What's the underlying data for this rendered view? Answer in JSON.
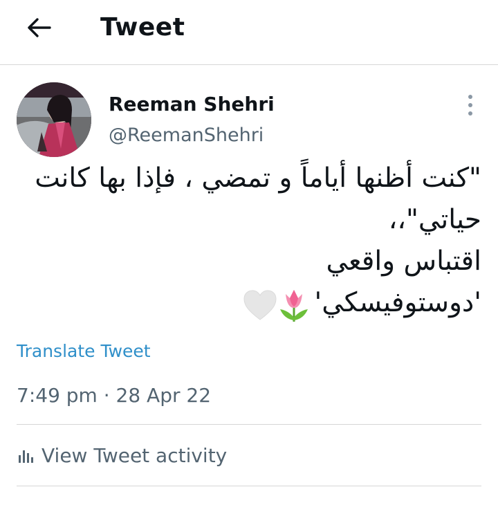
{
  "header": {
    "title": "Tweet",
    "back_icon": "arrow-left-icon"
  },
  "author": {
    "name": "Reeman Shehri",
    "handle": "@ReemanShehri",
    "more_icon": "more-vertical-icon"
  },
  "tweet": {
    "lines": [
      "\"كنت أظنها أياماً و تمضي ، فإذا بها كانت",
      "حياتي\"،،",
      "اقتباس واقعي",
      "'دوستوفيسكي'"
    ],
    "emojis": [
      "tulip-icon",
      "white-heart-icon"
    ]
  },
  "translate_label": "Translate Tweet",
  "timestamp": "7:49 pm · 28 Apr 22",
  "activity": {
    "label": "View Tweet activity",
    "icon": "bar-chart-icon"
  },
  "colors": {
    "link": "#2f8fc9",
    "secondary_text": "#536471",
    "divider": "#d6d6d6"
  }
}
